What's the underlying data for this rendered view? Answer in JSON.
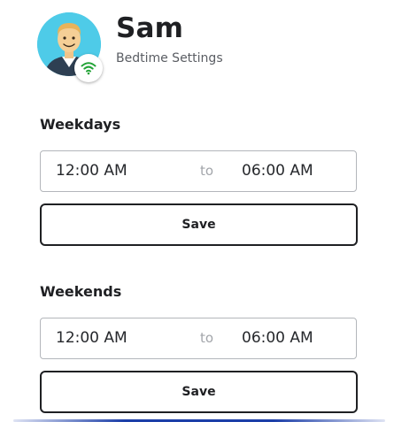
{
  "profile": {
    "name": "Sam",
    "subtitle": "Bedtime Settings",
    "status_icon": "wifi-icon",
    "status_color": "#21a336",
    "avatar_bg": "#4ecbe8"
  },
  "weekdays": {
    "title": "Weekdays",
    "start_time": "12:00 AM",
    "separator": "to",
    "end_time": "06:00 AM",
    "save_label": "Save"
  },
  "weekends": {
    "title": "Weekends",
    "start_time": "12:00 AM",
    "separator": "to",
    "end_time": "06:00 AM",
    "save_label": "Save"
  },
  "colors": {
    "text": "#1f2023",
    "muted": "#a2a5aa",
    "accent_bar": "#1b3ea8"
  }
}
